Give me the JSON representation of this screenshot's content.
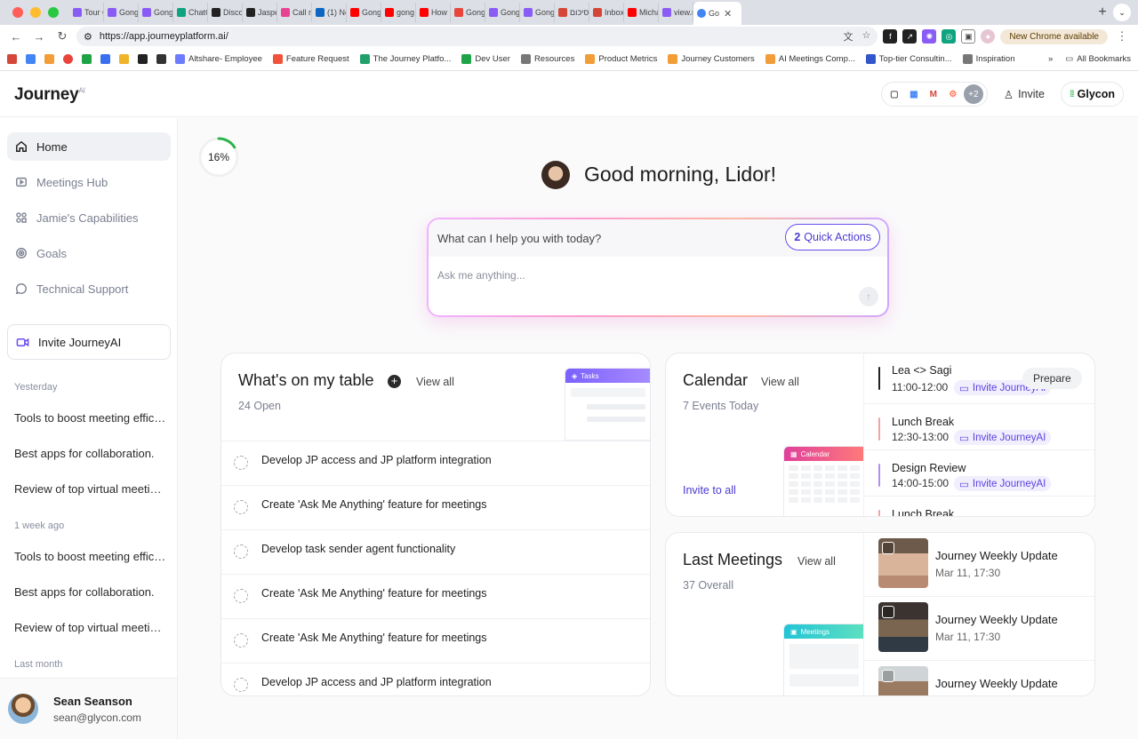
{
  "browser": {
    "tabs": [
      {
        "label": "Tour C",
        "color": "#8a5cf6"
      },
      {
        "label": "Gong -",
        "color": "#8a5cf6"
      },
      {
        "label": "Gong A",
        "color": "#8a5cf6"
      },
      {
        "label": "ChatGi",
        "color": "#10a37f"
      },
      {
        "label": "Discov",
        "color": "#222222"
      },
      {
        "label": "Jasper",
        "color": "#222222"
      },
      {
        "label": "Call re",
        "color": "#e84393"
      },
      {
        "label": "(1) Not",
        "color": "#0a66c2"
      },
      {
        "label": "Gong F",
        "color": "#ff0000"
      },
      {
        "label": "gong p",
        "color": "#ff0000"
      },
      {
        "label": "How G",
        "color": "#ff0000"
      },
      {
        "label": "Gong R",
        "color": "#e8453c"
      },
      {
        "label": "Gong f",
        "color": "#8a5cf6"
      },
      {
        "label": "Gong f",
        "color": "#8a5cf6"
      },
      {
        "label": "סיכום",
        "color": "#d44638"
      },
      {
        "label": "Inbox (",
        "color": "#d44638"
      },
      {
        "label": "Micha",
        "color": "#ff0000"
      },
      {
        "label": "view.m",
        "color": "#8a5cf6"
      }
    ],
    "active_tab": {
      "label": "Go"
    },
    "url": "https://app.journeyplatform.ai/",
    "new_chrome": "New Chrome available",
    "bookmarks": [
      {
        "label": "Altshare- Employee",
        "color": "#6d7cff"
      },
      {
        "label": "Feature Request",
        "color": "#f0533a"
      },
      {
        "label": "The Journey Platfo...",
        "color": "#22a06b"
      },
      {
        "label": "Dev User",
        "color": "#1ea446"
      },
      {
        "label": "Resources",
        "color": "#777777"
      },
      {
        "label": "Product Metrics",
        "color": "#f29d38"
      },
      {
        "label": "Journey Customers",
        "color": "#f29d38"
      },
      {
        "label": "AI Meetings Comp...",
        "color": "#f29d38"
      },
      {
        "label": "Top-tier Consultin...",
        "color": "#3355cc"
      },
      {
        "label": "Inspiration",
        "color": "#777777"
      }
    ],
    "bookmarks_more": "»",
    "all_bookmarks": "All Bookmarks"
  },
  "header": {
    "logo": "Journey",
    "logo_sup": "AI",
    "integrations_more": "+2",
    "invite": "Invite",
    "org": "Glycon"
  },
  "sidebar": {
    "nav": [
      {
        "label": "Home",
        "icon": "home-icon"
      },
      {
        "label": "Meetings Hub",
        "icon": "play-icon"
      },
      {
        "label": "Jamie's Capabilities",
        "icon": "grid-icon"
      },
      {
        "label": "Goals",
        "icon": "target-icon"
      },
      {
        "label": "Technical Support",
        "icon": "chat-icon"
      }
    ],
    "invite": "Invite JourneyAI",
    "sections": [
      {
        "label": "Yesterday",
        "items": [
          "Tools to boost meeting efficiency",
          "Best apps for collaboration.",
          "Review of top virtual meeting tools"
        ]
      },
      {
        "label": "1 week ago",
        "items": [
          "Tools to boost meeting efficiency",
          "Best apps for collaboration.",
          "Review of top virtual meeting tools"
        ]
      },
      {
        "label": "Last month",
        "items": []
      }
    ],
    "user": {
      "name": "Sean Seanson",
      "email": "sean@glycon.com"
    }
  },
  "main": {
    "progress": {
      "label": "16%",
      "value": 0.16
    },
    "greeting": "Good morning, Lidor!",
    "ask": {
      "title": "What can I help you with today?",
      "quick_count": "2",
      "quick_label": "Quick Actions",
      "placeholder": "Ask me anything..."
    },
    "table_card": {
      "title": "What's on my table",
      "view_all": "View all",
      "subtitle": "24 Open",
      "preview_label": "Tasks",
      "tasks": [
        "Develop JP access and JP platform integration",
        "Create 'Ask Me Anything' feature for meetings",
        "Develop task sender agent functionality",
        "Create 'Ask Me Anything' feature for meetings",
        "Create 'Ask Me Anything' feature for meetings",
        "Develop JP access and JP platform integration"
      ]
    },
    "calendar_card": {
      "title": "Calendar",
      "view_all": "View all",
      "subtitle": "7 Events Today",
      "invite_all": "Invite to all",
      "preview_label": "Calendar",
      "events": [
        {
          "title": "Lea <> Sagi",
          "time": "11:00-12:00",
          "link": "Invite JourneyAI",
          "color": "#222222",
          "prepare": "Prepare"
        },
        {
          "title": "Lunch Break",
          "time": "12:30-13:00",
          "link": "Invite JourneyAI",
          "color": "#f3a3a3"
        },
        {
          "title": "Design Review",
          "time": "14:00-15:00",
          "link": "Invite JourneyAI",
          "color": "#b58cf0"
        },
        {
          "title": "Lunch Break",
          "time": "",
          "link": "",
          "color": "#f3a3a3"
        }
      ]
    },
    "meetings_card": {
      "title": "Last Meetings",
      "view_all": "View all",
      "subtitle": "37  Overall",
      "preview_label": "Meetings",
      "meetings": [
        {
          "title": "Journey Weekly Update",
          "time": "Mar 11, 17:30"
        },
        {
          "title": "Journey Weekly Update",
          "time": "Mar 11, 17:30"
        },
        {
          "title": "Journey Weekly Update",
          "time": ""
        }
      ]
    }
  }
}
